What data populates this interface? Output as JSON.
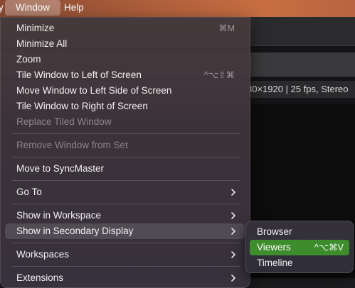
{
  "menubar": {
    "stub_label": "y",
    "window_label": "Window",
    "help_label": "Help"
  },
  "app": {
    "clip_info": "80×1920 | 25 fps, Stereo"
  },
  "menu": {
    "items": [
      {
        "label": "Minimize",
        "shortcut": "⌘M"
      },
      {
        "label": "Minimize All",
        "shortcut": ""
      },
      {
        "label": "Zoom",
        "shortcut": ""
      },
      {
        "label": "Tile Window to Left of Screen",
        "shortcut": "^⌥⇧⌘"
      },
      {
        "label": "Move Window to Left Side of Screen",
        "shortcut": ""
      },
      {
        "label": "Tile Window to Right of Screen",
        "shortcut": ""
      },
      {
        "label": "Replace Tiled Window",
        "shortcut": "",
        "disabled": true
      },
      {
        "label": "Remove Window from Set",
        "shortcut": "",
        "disabled": true
      },
      {
        "label": "Move to SyncMaster",
        "shortcut": ""
      },
      {
        "label": "Go To",
        "submenu": true
      },
      {
        "label": "Show in Workspace",
        "submenu": true
      },
      {
        "label": "Show in Secondary Display",
        "submenu": true,
        "highlighted": true
      },
      {
        "label": "Workspaces",
        "submenu": true
      },
      {
        "label": "Extensions",
        "submenu": true
      }
    ]
  },
  "submenu": {
    "items": [
      {
        "label": "Browser",
        "shortcut": ""
      },
      {
        "label": "Viewers",
        "shortcut": "^⌥⌘V",
        "selected": true
      },
      {
        "label": "Timeline",
        "shortcut": ""
      }
    ]
  },
  "colors": {
    "selection_green": "#3d8d2c",
    "menubar_accent": "#b0603c"
  }
}
